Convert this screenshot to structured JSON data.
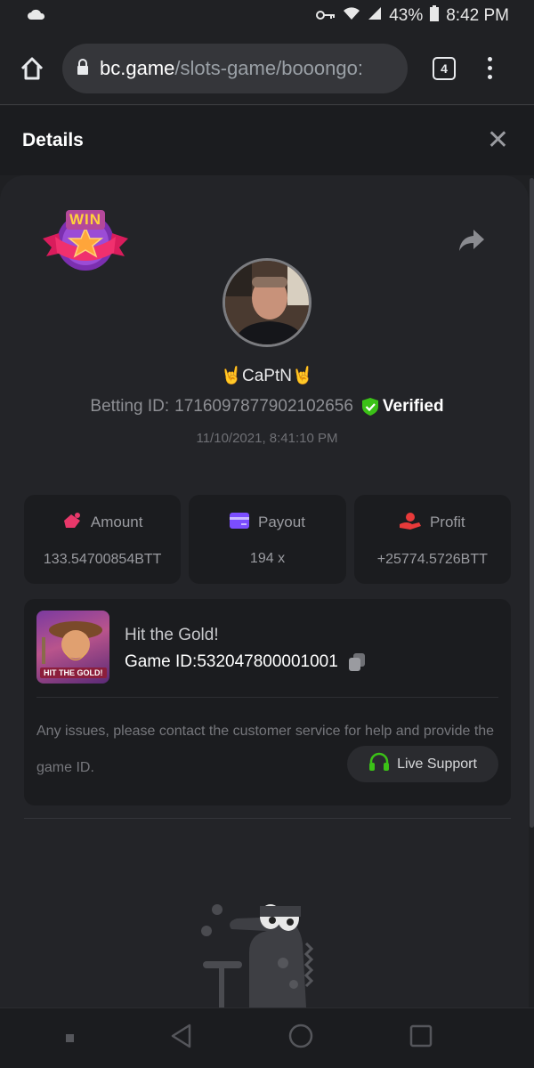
{
  "status_bar": {
    "battery": "43%",
    "time": "8:42 PM"
  },
  "browser": {
    "url_host": "bc.game",
    "url_path": "/slots-game/booongo:",
    "tab_count": "4"
  },
  "details": {
    "title": "Details",
    "close": "✕"
  },
  "bet": {
    "win_badge": "WIN",
    "username": "CaPtN",
    "username_emoji": "🤘",
    "betting_id_label": "Betting ID:",
    "betting_id": "1716097877902102656",
    "verified": "Verified",
    "timestamp": "11/10/2021, 8:41:10 PM"
  },
  "stats": [
    {
      "label": "Amount",
      "value": "133.54700854BTT",
      "color": "#e8386a",
      "icon": "bag-icon"
    },
    {
      "label": "Payout",
      "value": "194 x",
      "color": "#7b4dff",
      "icon": "card-icon"
    },
    {
      "label": "Profit",
      "value": "+25774.5726BTT",
      "color": "#e83a3a",
      "icon": "hand-coin-icon"
    }
  ],
  "game": {
    "thumbnail_label": "HIT THE GOLD!",
    "name": "Hit the Gold!",
    "id_label": "Game ID:",
    "id": "532047800001001",
    "issues_text": "Any issues, please contact the customer service for help and provide the game ID.",
    "support_label": "Live Support"
  },
  "colors": {
    "verified_green": "#3bc117",
    "support_green": "#3bc117",
    "background": "#232428",
    "card": "#1b1c1f"
  }
}
